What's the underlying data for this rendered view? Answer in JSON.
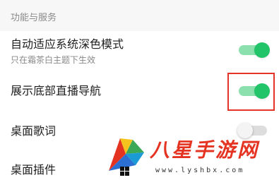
{
  "section": {
    "title": "功能与服务"
  },
  "settings": [
    {
      "label": "自动适应系统深色模式",
      "sub": "只在霜茶白主题下生效",
      "enabled": true
    },
    {
      "label": "展示底部直播导航",
      "enabled": true
    },
    {
      "label": "桌面歌词",
      "enabled": false
    },
    {
      "label": "桌面插件",
      "enabled": false
    }
  ],
  "watermark": {
    "text": "八星手游网",
    "url": "www.lyshbx.com"
  },
  "colors": {
    "toggle_on": "#22c46a",
    "toggle_on_track": "#8ce0ad",
    "toggle_off_track": "#dddddd",
    "highlight": "#e5332a",
    "header_bg": "#f7f7f7"
  }
}
